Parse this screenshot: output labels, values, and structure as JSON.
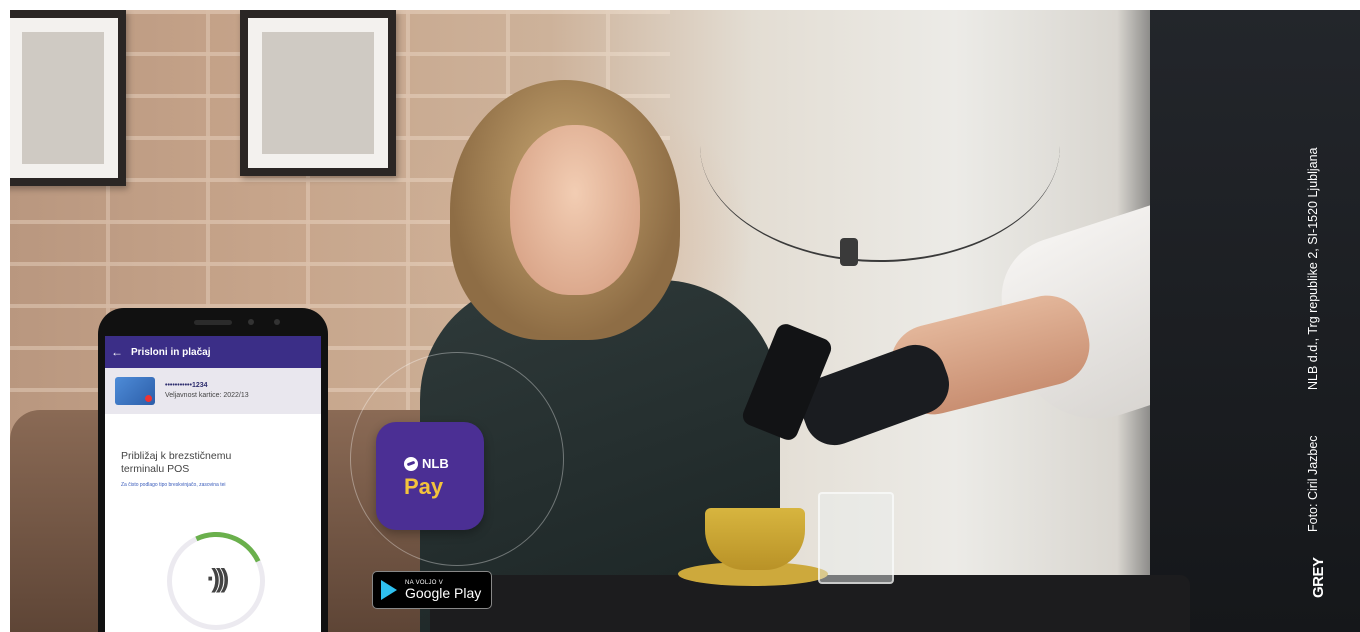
{
  "phone": {
    "title": "Prisloni in plačaj",
    "card_number": "•••••••••••1234",
    "card_caption": "Veljavnost kartice: 2022/13",
    "prompt_line1": "Približaj k brezstičnemu",
    "prompt_line2": "terminalu POS",
    "hint": "Za čisto podlago tipo breskvinjačo, zasovina tei",
    "contactless_glyph": "·)))"
  },
  "badge": {
    "brand": "NLB",
    "product": "Pay"
  },
  "store_badge": {
    "small": "NA VOLJO V",
    "big": "Google Play"
  },
  "credits": {
    "photo": "Foto: Ciril Jazbec",
    "address": "NLB d.d., Trg republike 2, SI-1520 Ljubljana",
    "agency": "GREY"
  },
  "colors": {
    "brand_purple": "#4b2f94",
    "pay_yellow": "#f3c33c"
  }
}
